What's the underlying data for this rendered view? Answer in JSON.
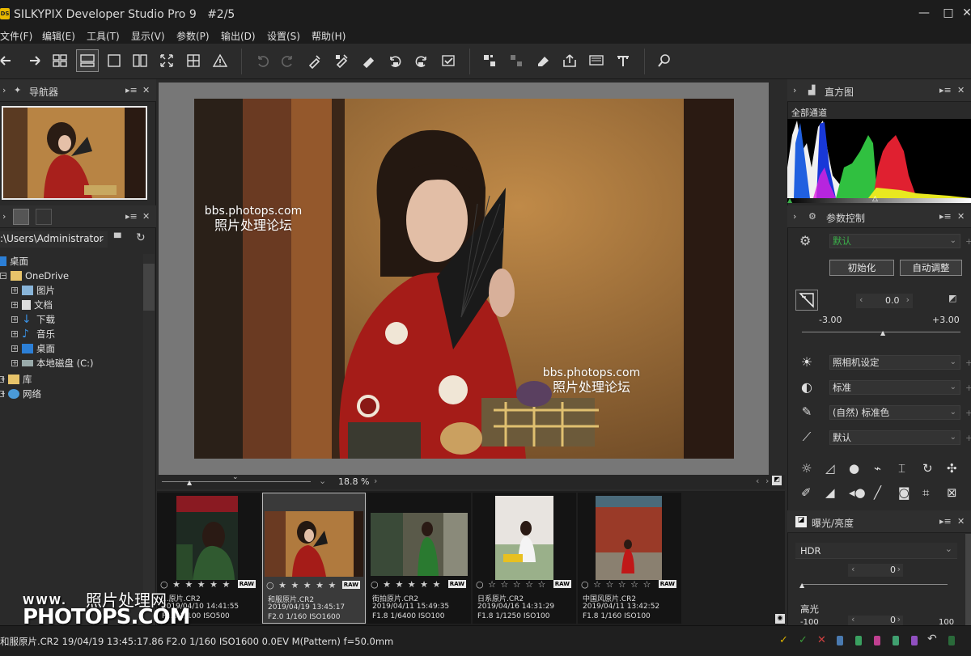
{
  "window": {
    "title": "SILKYPIX Developer Studio Pro 9   #2/5",
    "logo_text": "DS",
    "min": "—",
    "max": "□",
    "close": "✕"
  },
  "menu": [
    "文件(F)",
    "编辑(E)",
    "工具(T)",
    "显示(V)",
    "参数(P)",
    "输出(D)",
    "设置(S)",
    "帮助(H)"
  ],
  "navigator": {
    "title": "导航器"
  },
  "browser": {
    "path": ":\\Users\\Administrator",
    "tree": [
      {
        "label": "桌面"
      },
      {
        "label": "OneDrive"
      },
      {
        "label": "图片"
      },
      {
        "label": "文档"
      },
      {
        "label": "下载"
      },
      {
        "label": "音乐"
      },
      {
        "label": "桌面"
      },
      {
        "label": "本地磁盘 (C:)"
      },
      {
        "label": "库"
      },
      {
        "label": "网络"
      }
    ]
  },
  "preview": {
    "watermark_url": "bbs.photops.com",
    "watermark_cn": "照片处理论坛"
  },
  "zoom": {
    "value": "18.8 %"
  },
  "filmstrip": [
    {
      "stars": "○ ★ ★ ★ ★ ★",
      "raw": "RAW",
      "name": "...原片.CR2",
      "datetime": "2019/04/10 14:41:55",
      "exif": "F1.8 1/100 ISO500"
    },
    {
      "stars": "○ ★ ★ ★ ★ ★",
      "raw": "RAW",
      "name": "和服原片.CR2",
      "datetime": "2019/04/19 13:45:17",
      "exif": "F2.0 1/160 ISO1600"
    },
    {
      "stars": "○ ★ ★ ★ ★ ★",
      "raw": "RAW",
      "name": "街拍原片.CR2",
      "datetime": "2019/04/11 15:49:35",
      "exif": "F1.8 1/6400 ISO100"
    },
    {
      "stars": "○ ☆ ☆ ☆ ☆ ☆",
      "raw": "RAW",
      "name": "日系原片.CR2",
      "datetime": "2019/04/16 14:31:29",
      "exif": "F1.8 1/1250 ISO100"
    },
    {
      "stars": "○ ☆ ☆ ☆ ☆ ☆",
      "raw": "RAW",
      "name": "中国风原片.CR2",
      "datetime": "2019/04/11 13:42:52",
      "exif": "F1.8 1/160 ISO100"
    }
  ],
  "histogram": {
    "title": "直方图",
    "channel": "全部通道"
  },
  "params": {
    "title": "参数控制",
    "preset": "默认",
    "init_button": "初始化",
    "auto_button": "自动调整",
    "exposure_value": "0.0",
    "exposure_min": "-3.00",
    "exposure_max": "+3.00",
    "wb": "照相机设定",
    "tone": "标准",
    "color": "(自然) 标准色",
    "sharp": "默认"
  },
  "exposure_panel": {
    "title": "曝光/亮度",
    "mode": "HDR",
    "hdr_value": "0",
    "highlight_label": "高光",
    "highlight_value": "0",
    "highlight_min": "-100",
    "highlight_max": "100"
  },
  "status": {
    "text": "和服原片.CR2 19/04/19 13:45:17.86 F2.0 1/160 ISO1600  0.0EV M(Pattern) f=50.0mm"
  },
  "site_watermark": {
    "line1": "WWW.",
    "line1_cn": "照片处理网",
    "line2": "PHOTOPS.COM"
  },
  "colors": {
    "accent_green": "#3bb04a",
    "panel_bg": "#2a2a2a",
    "title_bg": "#1c1c1c"
  }
}
